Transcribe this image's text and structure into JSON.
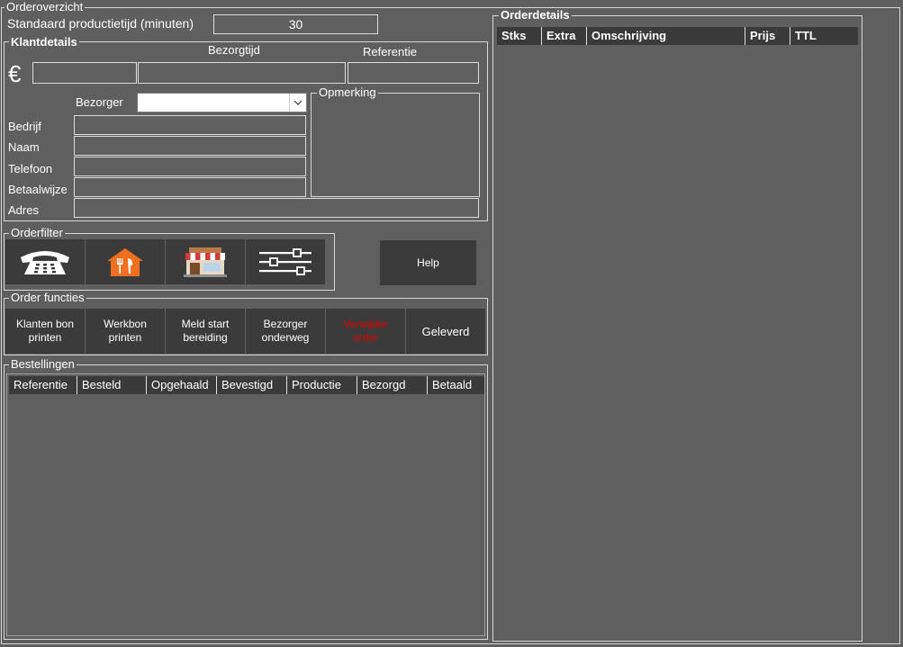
{
  "window": {
    "title": "Orderoverzicht"
  },
  "production": {
    "label": "Standaard productietijd (minuten)",
    "value": "30"
  },
  "customer": {
    "group_title": "Klantdetails",
    "currency_symbol": "€",
    "delivery_time_label": "Bezorgtijd",
    "reference_label": "Referentie",
    "courier_label": "Bezorger",
    "remark_label": "Opmerking",
    "fields": {
      "company": "Bedrijf",
      "name": "Naam",
      "phone": "Telefoon",
      "payment": "Betaalwijze",
      "address": "Adres"
    }
  },
  "order_filter": {
    "title": "Orderfilter",
    "icons": [
      "telephone-icon",
      "takeaway-house-icon",
      "store-front-icon",
      "filter-sliders-icon"
    ],
    "help_label": "Help"
  },
  "order_functions": {
    "title": "Order functies",
    "buttons": [
      {
        "label": "Klanten bon printen"
      },
      {
        "label": "Werkbon printen"
      },
      {
        "label": "Meld start bereiding"
      },
      {
        "label": "Bezorger onderweg"
      },
      {
        "label": "Verwijder order"
      },
      {
        "label": "Geleverd"
      }
    ],
    "delete_color": "#e00000"
  },
  "orders": {
    "title": "Bestellingen",
    "columns": [
      "Referentie",
      "Besteld",
      "Opgehaald",
      "Bevestigd",
      "Productie",
      "Bezorgd",
      "Betaald"
    ]
  },
  "order_details": {
    "title": "Orderdetails",
    "columns": [
      "Stks",
      "Extra",
      "Omschrijving",
      "Prijs",
      "TTL"
    ]
  }
}
